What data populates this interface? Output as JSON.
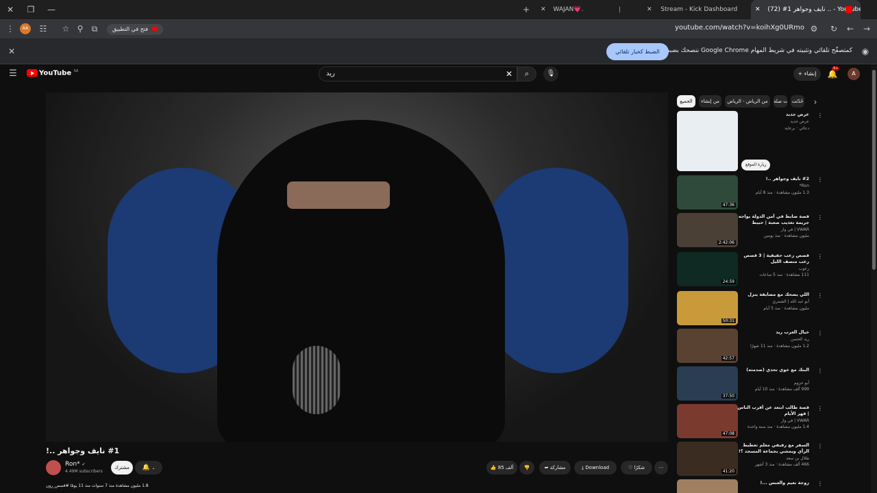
{
  "browser": {
    "tabs": [
      {
        "label": "WAJAN💗."
      },
      {
        "label": "Stream - Kick Dashboard"
      },
      {
        "label": "(72) #1 نايف وجواهر .. - YouTube"
      }
    ],
    "url": "youtube.com/watch?v=koihXg0URmo",
    "open_app_label": "فتح في التطبيق",
    "zoom_badge": "AA"
  },
  "infobar": {
    "message": "ننصحك بضبط Google Chrome كمتصفّح تلقائي وتثبيته في شريط المهام",
    "button": "الضبط كخيار تلقائي"
  },
  "youtube": {
    "logo_text": "YouTube",
    "logo_region": "SA",
    "search_query": "ريد",
    "create_label": "إنشاء",
    "notification_count": "9+",
    "avatar_letter": "A"
  },
  "video": {
    "title": "#1 نايف وجواهر ..!",
    "channel": "Ron*",
    "subscribers": "4.49M subscribers",
    "subscribe_label": "مشترك",
    "likes": "85 ألف",
    "share_label": "مشاركة",
    "download_label": "Download",
    "thanks_label": "شكرًا",
    "description_line": "1.8 مليون مشاهدة منذ 7 سنوات منذ 11 يومًا #قصص_رون"
  },
  "chips": [
    {
      "label": "الجميع",
      "selected": true
    },
    {
      "label": "من إنشاء"
    },
    {
      "label": "من الرياض - الرياض"
    },
    {
      "label": "ذات صلة"
    },
    {
      "label": "حُدّثت"
    }
  ],
  "recommendations": [
    {
      "title": "عرض جديد",
      "channel": "عرض جديد",
      "meta": "دعائي · برعاية",
      "duration": "",
      "thumb_color": "#e9eef3",
      "extra": "زيارة الموقع"
    },
    {
      "title": "#2 نايف وجواهر ..!",
      "channel": "Ron*",
      "meta": "1.3 مليون مشاهدة · منذ 8 أيام",
      "duration": "47:36",
      "thumb_color": "#2f4a3a"
    },
    {
      "title": "قصة ضابط في أمن الدولة يواجه جريمة تعذيب صعبة | حبيط التحريات",
      "channel": "VWAR | في وار",
      "meta": "مليون مشاهدة · منذ يومين",
      "duration": "2:42:06",
      "thumb_color": "#4a4036"
    },
    {
      "title": "قصص رعب حقيقية | 3 قصص رعب متصف الليل",
      "channel": "رعوب",
      "meta": "111 مشاهدة · منذ 5 ساعات",
      "duration": "24:59",
      "thumb_color": "#0e2a22"
    },
    {
      "title": "اللي يضحك مع مضايقة ينزل",
      "channel": "أبو عبد الله | الشمري",
      "meta": "مليون مشاهدة · منذ 5 أيام",
      "duration": "50:31",
      "thumb_color": "#c89a3a"
    },
    {
      "title": "خيال العرب ريد",
      "channel": "ريد الحسن",
      "meta": "1.2 مليون مشاهدة · منذ 11 شهرًا",
      "duration": "42:57",
      "thumb_color": "#5a4232"
    },
    {
      "title": "البنك مع خوي تحدي (صدمته)",
      "channel": "أبو حزوم",
      "meta": "999 ألف مشاهدة · منذ 10 أيام",
      "duration": "37:50",
      "thumb_color": "#2a3d52"
    },
    {
      "title": "قصة طالب ابتعد عن أقرب الناس | قهر الأيام",
      "channel": "VWAR | في وار",
      "meta": "1.4 مليون مشاهدة · منذ سنة واحدة",
      "duration": "47:08",
      "thumb_color": "#7a3b2e"
    },
    {
      "title": "السفر مع رفيقي معلم تعطيط الرأي ويمشي بجماعة المسجد ؟!",
      "channel": "طلال بن سعد",
      "meta": "466 ألف مشاهدة · منذ 3 أشهر",
      "duration": "41:20",
      "thumb_color": "#3a2c20"
    },
    {
      "title": "زوجة نعيم والعبس ...!",
      "channel": "",
      "meta": "",
      "duration": "",
      "thumb_color": "#a08060"
    }
  ]
}
